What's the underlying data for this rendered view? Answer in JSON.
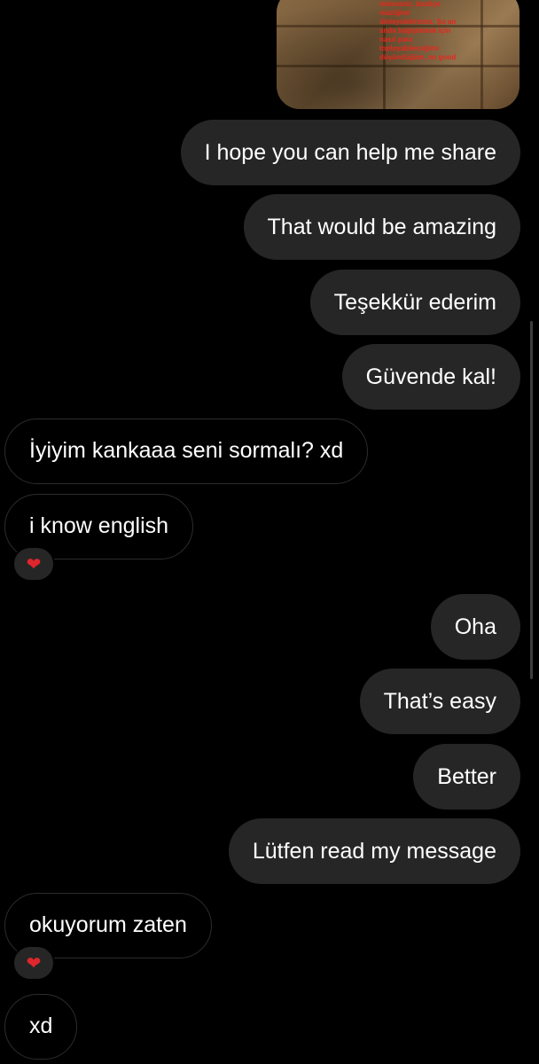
{
  "media": {
    "caption": "isterseniz, basitçe\nmüziğimi\ndinleyebilirsiniz. Şu an\nanda bağışlamak için\nnasıl para\ntoplayabileceğimi\ndüşündüğüm, so good"
  },
  "messages": [
    {
      "direction": "sent",
      "text": "I hope you can help me share"
    },
    {
      "direction": "sent",
      "text": "That would be amazing"
    },
    {
      "direction": "sent",
      "text": "Teşekkür ederim"
    },
    {
      "direction": "sent",
      "text": "Güvende kal!"
    },
    {
      "direction": "received",
      "text": "İyiyim kankaaa seni sormalı? xd"
    },
    {
      "direction": "received",
      "text": "i know english",
      "reaction": "❤"
    },
    {
      "direction": "sent",
      "text": "Oha"
    },
    {
      "direction": "sent",
      "text": "That’s easy"
    },
    {
      "direction": "sent",
      "text": "Better"
    },
    {
      "direction": "sent",
      "text": "Lütfen read my message"
    },
    {
      "direction": "received",
      "text": "okuyorum zaten",
      "reaction": "❤"
    },
    {
      "direction": "received",
      "text": "xd"
    }
  ],
  "colors": {
    "background": "#000000",
    "sent_bubble": "#262626",
    "received_border": "#2c2c2c",
    "text": "#ffffff",
    "reaction_heart": "#e0262c",
    "caption_red": "#e8261c"
  }
}
